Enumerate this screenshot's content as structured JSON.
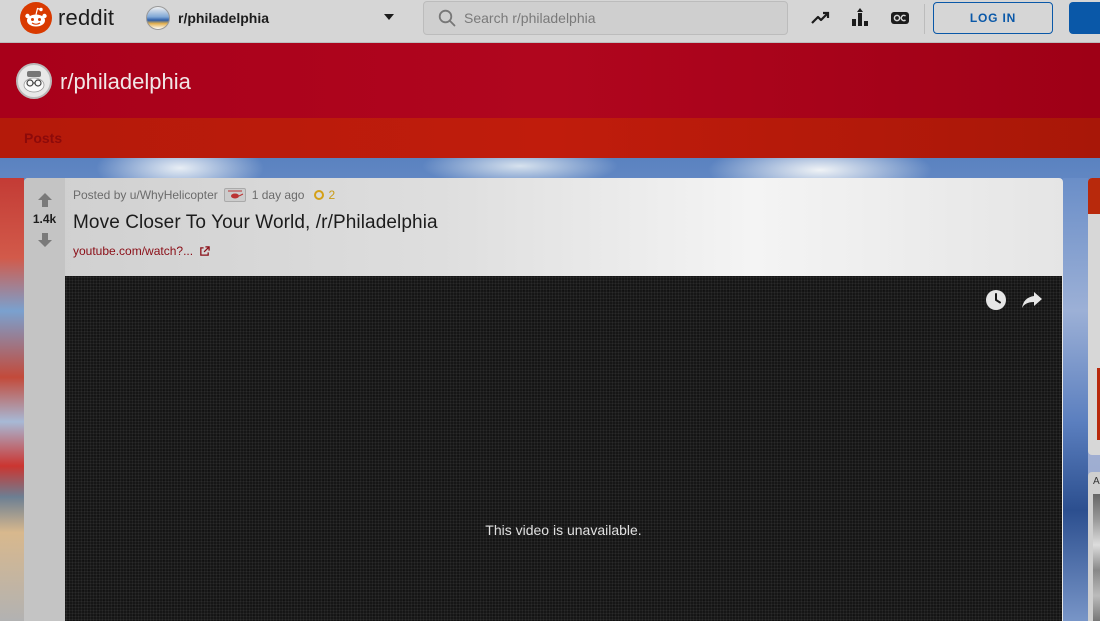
{
  "header": {
    "logo_text": "reddit",
    "subreddit_selector": "r/philadelphia",
    "search_placeholder": "Search r/philadelphia",
    "login_label": "LOG IN",
    "icons": [
      "trending-icon",
      "popular-icon",
      "oc-icon"
    ]
  },
  "banner": {
    "title": "r/philadelphia",
    "tab_posts": "Posts"
  },
  "post": {
    "score": "1.4k",
    "posted_by": "Posted by u/WhyHelicopter",
    "time_ago": "1 day ago",
    "award_count": "2",
    "title": "Move Closer To Your World, /r/Philadelphia",
    "link_text": "youtube.com/watch?...",
    "video_message": "This video is unavailable."
  },
  "sidebar": {
    "card2_letter": "A"
  },
  "colors": {
    "brand": "#d93a00",
    "banner": "#a8001a",
    "link": "#8a0d16",
    "login": "#0a58a8"
  }
}
